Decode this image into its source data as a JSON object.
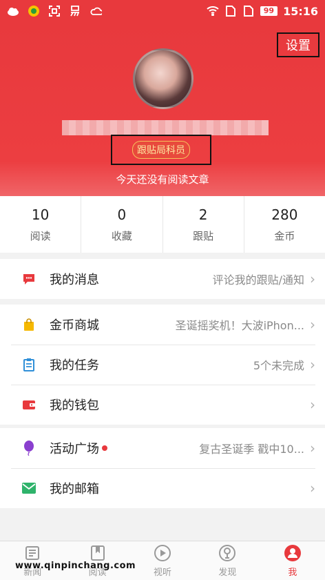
{
  "status_bar": {
    "battery": "99",
    "time": "15:16",
    "left_icons": [
      "cloud-icon",
      "app-icon",
      "scan-icon",
      "yi-icon",
      "cloud-outline-icon"
    ],
    "right_icons": [
      "wifi-icon",
      "sim-icon",
      "sim-icon-2"
    ]
  },
  "header": {
    "settings_label": "设置",
    "title_badge": "跟贴局科员",
    "subtitle": "今天还没有阅读文章"
  },
  "stats": [
    {
      "value": "10",
      "label": "阅读"
    },
    {
      "value": "0",
      "label": "收藏"
    },
    {
      "value": "2",
      "label": "跟贴"
    },
    {
      "value": "280",
      "label": "金币"
    }
  ],
  "menu": {
    "messages": {
      "label": "我的消息",
      "detail": "评论我的跟贴/通知"
    },
    "coin_mall": {
      "label": "金币商城",
      "detail": "圣诞摇奖机！大波iPhon..."
    },
    "tasks": {
      "label": "我的任务",
      "detail": "5个未完成"
    },
    "wallet": {
      "label": "我的钱包",
      "detail": ""
    },
    "activity": {
      "label": "活动广场",
      "detail": "复古圣诞季 戳中10..."
    },
    "mailbox": {
      "label": "我的邮箱",
      "detail": ""
    }
  },
  "tabs": [
    {
      "label": "新闻",
      "icon": "news-icon"
    },
    {
      "label": "阅读",
      "icon": "reading-icon"
    },
    {
      "label": "视听",
      "icon": "play-icon"
    },
    {
      "label": "发现",
      "icon": "discover-icon"
    },
    {
      "label": "我",
      "icon": "profile-icon",
      "active": true
    }
  ],
  "watermark": "www.qinpinchang.com",
  "colors": {
    "brand": "#e8393d",
    "badge_border": "#f6c25b"
  }
}
